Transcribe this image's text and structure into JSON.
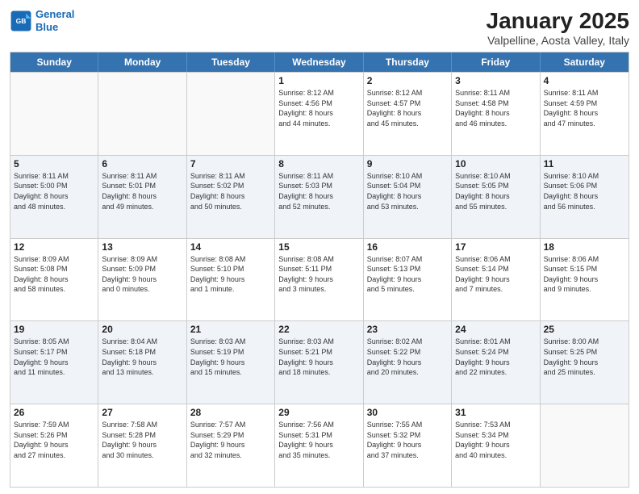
{
  "logo": {
    "line1": "General",
    "line2": "Blue"
  },
  "title": "January 2025",
  "location": "Valpelline, Aosta Valley, Italy",
  "days_of_week": [
    "Sunday",
    "Monday",
    "Tuesday",
    "Wednesday",
    "Thursday",
    "Friday",
    "Saturday"
  ],
  "weeks": [
    [
      {
        "day": "",
        "info": ""
      },
      {
        "day": "",
        "info": ""
      },
      {
        "day": "",
        "info": ""
      },
      {
        "day": "1",
        "info": "Sunrise: 8:12 AM\nSunset: 4:56 PM\nDaylight: 8 hours\nand 44 minutes."
      },
      {
        "day": "2",
        "info": "Sunrise: 8:12 AM\nSunset: 4:57 PM\nDaylight: 8 hours\nand 45 minutes."
      },
      {
        "day": "3",
        "info": "Sunrise: 8:11 AM\nSunset: 4:58 PM\nDaylight: 8 hours\nand 46 minutes."
      },
      {
        "day": "4",
        "info": "Sunrise: 8:11 AM\nSunset: 4:59 PM\nDaylight: 8 hours\nand 47 minutes."
      }
    ],
    [
      {
        "day": "5",
        "info": "Sunrise: 8:11 AM\nSunset: 5:00 PM\nDaylight: 8 hours\nand 48 minutes."
      },
      {
        "day": "6",
        "info": "Sunrise: 8:11 AM\nSunset: 5:01 PM\nDaylight: 8 hours\nand 49 minutes."
      },
      {
        "day": "7",
        "info": "Sunrise: 8:11 AM\nSunset: 5:02 PM\nDaylight: 8 hours\nand 50 minutes."
      },
      {
        "day": "8",
        "info": "Sunrise: 8:11 AM\nSunset: 5:03 PM\nDaylight: 8 hours\nand 52 minutes."
      },
      {
        "day": "9",
        "info": "Sunrise: 8:10 AM\nSunset: 5:04 PM\nDaylight: 8 hours\nand 53 minutes."
      },
      {
        "day": "10",
        "info": "Sunrise: 8:10 AM\nSunset: 5:05 PM\nDaylight: 8 hours\nand 55 minutes."
      },
      {
        "day": "11",
        "info": "Sunrise: 8:10 AM\nSunset: 5:06 PM\nDaylight: 8 hours\nand 56 minutes."
      }
    ],
    [
      {
        "day": "12",
        "info": "Sunrise: 8:09 AM\nSunset: 5:08 PM\nDaylight: 8 hours\nand 58 minutes."
      },
      {
        "day": "13",
        "info": "Sunrise: 8:09 AM\nSunset: 5:09 PM\nDaylight: 9 hours\nand 0 minutes."
      },
      {
        "day": "14",
        "info": "Sunrise: 8:08 AM\nSunset: 5:10 PM\nDaylight: 9 hours\nand 1 minute."
      },
      {
        "day": "15",
        "info": "Sunrise: 8:08 AM\nSunset: 5:11 PM\nDaylight: 9 hours\nand 3 minutes."
      },
      {
        "day": "16",
        "info": "Sunrise: 8:07 AM\nSunset: 5:13 PM\nDaylight: 9 hours\nand 5 minutes."
      },
      {
        "day": "17",
        "info": "Sunrise: 8:06 AM\nSunset: 5:14 PM\nDaylight: 9 hours\nand 7 minutes."
      },
      {
        "day": "18",
        "info": "Sunrise: 8:06 AM\nSunset: 5:15 PM\nDaylight: 9 hours\nand 9 minutes."
      }
    ],
    [
      {
        "day": "19",
        "info": "Sunrise: 8:05 AM\nSunset: 5:17 PM\nDaylight: 9 hours\nand 11 minutes."
      },
      {
        "day": "20",
        "info": "Sunrise: 8:04 AM\nSunset: 5:18 PM\nDaylight: 9 hours\nand 13 minutes."
      },
      {
        "day": "21",
        "info": "Sunrise: 8:03 AM\nSunset: 5:19 PM\nDaylight: 9 hours\nand 15 minutes."
      },
      {
        "day": "22",
        "info": "Sunrise: 8:03 AM\nSunset: 5:21 PM\nDaylight: 9 hours\nand 18 minutes."
      },
      {
        "day": "23",
        "info": "Sunrise: 8:02 AM\nSunset: 5:22 PM\nDaylight: 9 hours\nand 20 minutes."
      },
      {
        "day": "24",
        "info": "Sunrise: 8:01 AM\nSunset: 5:24 PM\nDaylight: 9 hours\nand 22 minutes."
      },
      {
        "day": "25",
        "info": "Sunrise: 8:00 AM\nSunset: 5:25 PM\nDaylight: 9 hours\nand 25 minutes."
      }
    ],
    [
      {
        "day": "26",
        "info": "Sunrise: 7:59 AM\nSunset: 5:26 PM\nDaylight: 9 hours\nand 27 minutes."
      },
      {
        "day": "27",
        "info": "Sunrise: 7:58 AM\nSunset: 5:28 PM\nDaylight: 9 hours\nand 30 minutes."
      },
      {
        "day": "28",
        "info": "Sunrise: 7:57 AM\nSunset: 5:29 PM\nDaylight: 9 hours\nand 32 minutes."
      },
      {
        "day": "29",
        "info": "Sunrise: 7:56 AM\nSunset: 5:31 PM\nDaylight: 9 hours\nand 35 minutes."
      },
      {
        "day": "30",
        "info": "Sunrise: 7:55 AM\nSunset: 5:32 PM\nDaylight: 9 hours\nand 37 minutes."
      },
      {
        "day": "31",
        "info": "Sunrise: 7:53 AM\nSunset: 5:34 PM\nDaylight: 9 hours\nand 40 minutes."
      },
      {
        "day": "",
        "info": ""
      }
    ]
  ]
}
